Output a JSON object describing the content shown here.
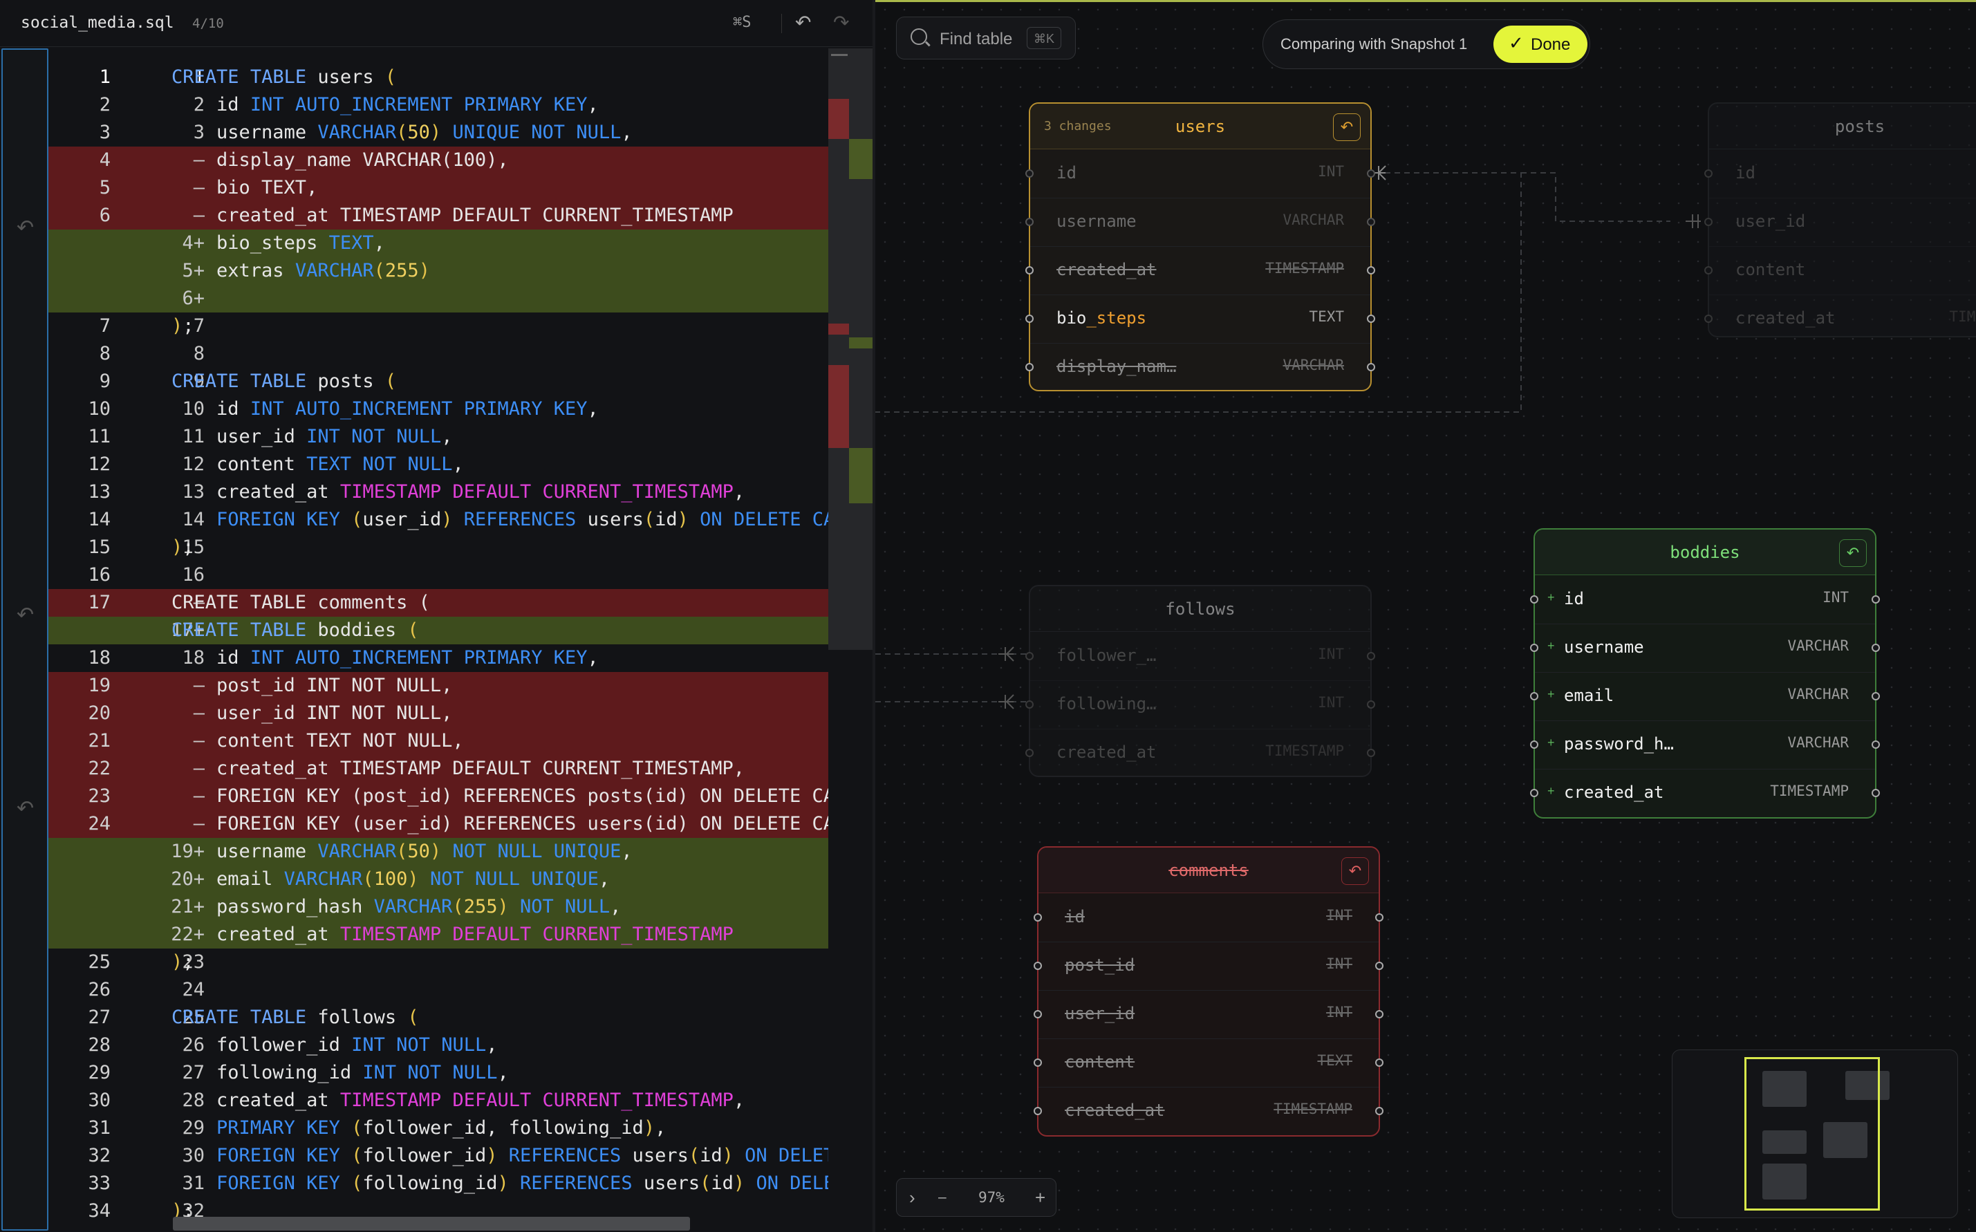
{
  "editor": {
    "filename": "social_media.sql",
    "counter": "4/10",
    "save_shortcut": "⌘S",
    "undo_icon": "undo-icon",
    "redo_icon": "redo-icon",
    "lines": [
      {
        "o": "1",
        "n": "1",
        "k": "ctx",
        "t": "CREATE TABLE users ("
      },
      {
        "o": "2",
        "n": "2",
        "k": "ctx",
        "t": "    id INT AUTO_INCREMENT PRIMARY KEY,"
      },
      {
        "o": "3",
        "n": "3",
        "k": "ctx",
        "t": "    username VARCHAR(50) UNIQUE NOT NULL,"
      },
      {
        "o": "4",
        "n": "–",
        "k": "del",
        "t": "    display_name VARCHAR(100),"
      },
      {
        "o": "5",
        "n": "–",
        "k": "del",
        "t": "    bio TEXT,"
      },
      {
        "o": "6",
        "n": "–",
        "k": "del",
        "t": "    created_at TIMESTAMP DEFAULT CURRENT_TIMESTAMP"
      },
      {
        "o": "",
        "n": "4+",
        "k": "add",
        "t": "    bio_steps TEXT,"
      },
      {
        "o": "",
        "n": "5+",
        "k": "add",
        "t": "    extras VARCHAR(255)"
      },
      {
        "o": "",
        "n": "6+",
        "k": "add",
        "t": ""
      },
      {
        "o": "7",
        "n": "7",
        "k": "ctx",
        "t": ");"
      },
      {
        "o": "8",
        "n": "8",
        "k": "ctx",
        "t": ""
      },
      {
        "o": "9",
        "n": "9",
        "k": "ctx",
        "t": "CREATE TABLE posts ("
      },
      {
        "o": "10",
        "n": "10",
        "k": "ctx",
        "t": "    id INT AUTO_INCREMENT PRIMARY KEY,"
      },
      {
        "o": "11",
        "n": "11",
        "k": "ctx",
        "t": "    user_id INT NOT NULL,"
      },
      {
        "o": "12",
        "n": "12",
        "k": "ctx",
        "t": "    content TEXT NOT NULL,"
      },
      {
        "o": "13",
        "n": "13",
        "k": "ctx",
        "t": "    created_at TIMESTAMP DEFAULT CURRENT_TIMESTAMP,"
      },
      {
        "o": "14",
        "n": "14",
        "k": "ctx",
        "t": "    FOREIGN KEY (user_id) REFERENCES users(id) ON DELETE CASC"
      },
      {
        "o": "15",
        "n": "15",
        "k": "ctx",
        "t": ");"
      },
      {
        "o": "16",
        "n": "16",
        "k": "ctx",
        "t": ""
      },
      {
        "o": "17",
        "n": "–",
        "k": "del",
        "t": "CREATE TABLE comments ("
      },
      {
        "o": "",
        "n": "17+",
        "k": "add",
        "t": "CREATE TABLE boddies ("
      },
      {
        "o": "18",
        "n": "18",
        "k": "ctx",
        "t": "    id INT AUTO_INCREMENT PRIMARY KEY,"
      },
      {
        "o": "19",
        "n": "–",
        "k": "del",
        "t": "    post_id INT NOT NULL,"
      },
      {
        "o": "20",
        "n": "–",
        "k": "del",
        "t": "    user_id INT NOT NULL,"
      },
      {
        "o": "21",
        "n": "–",
        "k": "del",
        "t": "    content TEXT NOT NULL,"
      },
      {
        "o": "22",
        "n": "–",
        "k": "del",
        "t": "    created_at TIMESTAMP DEFAULT CURRENT_TIMESTAMP,"
      },
      {
        "o": "23",
        "n": "–",
        "k": "del",
        "t": "    FOREIGN KEY (post_id) REFERENCES posts(id) ON DELETE CASC"
      },
      {
        "o": "24",
        "n": "–",
        "k": "del",
        "t": "    FOREIGN KEY (user_id) REFERENCES users(id) ON DELETE CASC"
      },
      {
        "o": "",
        "n": "19+",
        "k": "add",
        "t": "    username VARCHAR(50) NOT NULL UNIQUE,"
      },
      {
        "o": "",
        "n": "20+",
        "k": "add",
        "t": "    email VARCHAR(100) NOT NULL UNIQUE,"
      },
      {
        "o": "",
        "n": "21+",
        "k": "add",
        "t": "    password_hash VARCHAR(255) NOT NULL,"
      },
      {
        "o": "",
        "n": "22+",
        "k": "add",
        "t": "    created_at TIMESTAMP DEFAULT CURRENT_TIMESTAMP"
      },
      {
        "o": "25",
        "n": "23",
        "k": "ctx",
        "t": ");"
      },
      {
        "o": "26",
        "n": "24",
        "k": "ctx",
        "t": ""
      },
      {
        "o": "27",
        "n": "25",
        "k": "ctx",
        "t": "CREATE TABLE follows ("
      },
      {
        "o": "28",
        "n": "26",
        "k": "ctx",
        "t": "    follower_id INT NOT NULL,"
      },
      {
        "o": "29",
        "n": "27",
        "k": "ctx",
        "t": "    following_id INT NOT NULL,"
      },
      {
        "o": "30",
        "n": "28",
        "k": "ctx",
        "t": "    created_at TIMESTAMP DEFAULT CURRENT_TIMESTAMP,"
      },
      {
        "o": "31",
        "n": "29",
        "k": "ctx",
        "t": "    PRIMARY KEY (follower_id, following_id),"
      },
      {
        "o": "32",
        "n": "30",
        "k": "ctx",
        "t": "    FOREIGN KEY (follower_id) REFERENCES users(id) ON DELETE"
      },
      {
        "o": "33",
        "n": "31",
        "k": "ctx",
        "t": "    FOREIGN KEY (following_id) REFERENCES users(id) ON DELETE"
      },
      {
        "o": "34",
        "n": "32",
        "k": "ctx",
        "t": ");"
      }
    ]
  },
  "canvas": {
    "find_label": "Find table",
    "find_shortcut": "⌘K",
    "compare_label": "Comparing with Snapshot 1",
    "done_label": "Done",
    "zoom_level": "97%",
    "zoom_minus": "–",
    "zoom_plus": "+",
    "zoom_expand": "›",
    "colors": {
      "accent": "#e4f53a",
      "added": "#3a6e3a",
      "removed": "#8a2a2a",
      "modified": "#c8a030"
    },
    "tables": {
      "users": {
        "name": "users",
        "changes": "3 changes",
        "columns": [
          {
            "name": "id",
            "type": "INT",
            "state": "dim"
          },
          {
            "name": "username",
            "type": "VARCHAR",
            "state": "dim"
          },
          {
            "name": "created_at",
            "type": "TIMESTAMP",
            "state": "removed"
          },
          {
            "name_a": "bio",
            "name_b": "_steps",
            "type": "TEXT",
            "state": "modified"
          },
          {
            "name": "display_nam…",
            "type": "VARCHAR",
            "state": "removed"
          }
        ]
      },
      "posts": {
        "name": "posts",
        "columns": [
          {
            "name": "id",
            "type": "",
            "state": "dim"
          },
          {
            "name": "user_id",
            "type": "",
            "state": "dim"
          },
          {
            "name": "content",
            "type": "",
            "state": "dim"
          },
          {
            "name": "created_at",
            "type": "TIME",
            "state": "dim"
          }
        ]
      },
      "boddies": {
        "name": "boddies",
        "columns": [
          {
            "name": "id",
            "type": "INT",
            "state": "added"
          },
          {
            "name": "username",
            "type": "VARCHAR",
            "state": "added"
          },
          {
            "name": "email",
            "type": "VARCHAR",
            "state": "added"
          },
          {
            "name": "password_h…",
            "type": "VARCHAR",
            "state": "added"
          },
          {
            "name": "created_at",
            "type": "TIMESTAMP",
            "state": "added"
          }
        ]
      },
      "follows": {
        "name": "follows",
        "columns": [
          {
            "name": "follower_…",
            "type": "INT",
            "state": "dim"
          },
          {
            "name": "following…",
            "type": "INT",
            "state": "dim"
          },
          {
            "name": "created_at",
            "type": "TIMESTAMP",
            "state": "dim"
          }
        ]
      },
      "comments": {
        "name": "comments",
        "columns": [
          {
            "name": "id",
            "type": "INT",
            "state": "removed"
          },
          {
            "name": "post_id",
            "type": "INT",
            "state": "removed"
          },
          {
            "name": "user_id",
            "type": "INT",
            "state": "removed"
          },
          {
            "name": "content",
            "type": "TEXT",
            "state": "removed"
          },
          {
            "name": "created_at",
            "type": "TIMESTAMP",
            "state": "removed"
          }
        ]
      }
    }
  }
}
